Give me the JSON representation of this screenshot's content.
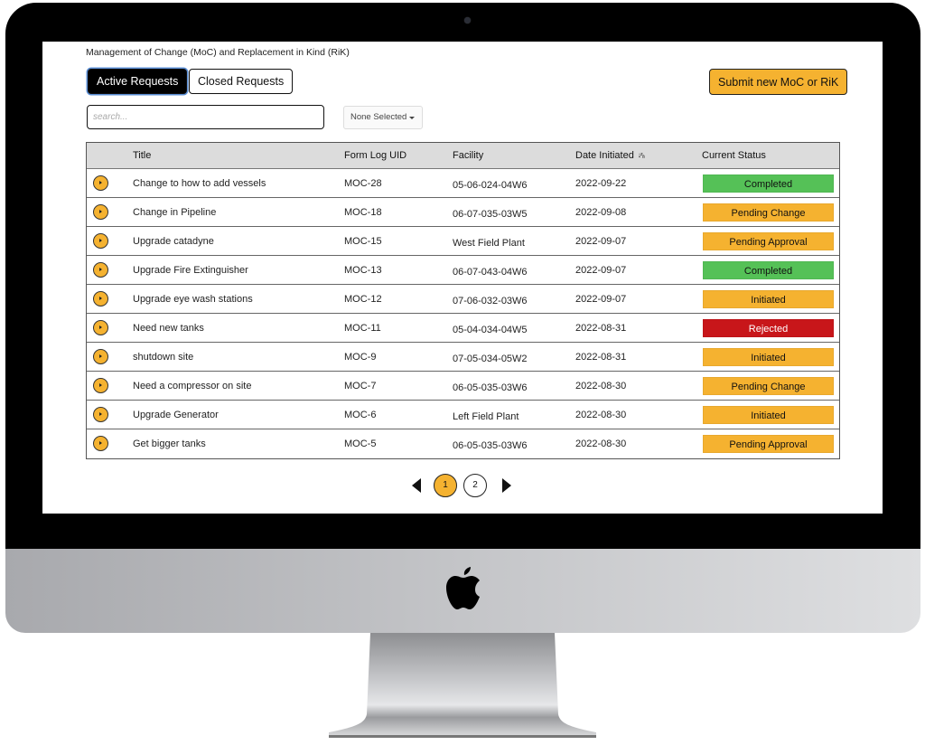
{
  "app": {
    "title": "Management of Change (MoC) and Replacement in Kind (RiK)"
  },
  "tabs": [
    {
      "label": "Active Requests",
      "active": true
    },
    {
      "label": "Closed Requests",
      "active": false
    }
  ],
  "toolbar": {
    "submit_label": "Submit new MoC or RiK",
    "search_placeholder": "search...",
    "search_value": "",
    "filter_selected": "None Selected"
  },
  "table": {
    "columns": [
      "Title",
      "Form Log UID",
      "Facility",
      "Date Initiated",
      "Current Status"
    ],
    "sort": {
      "column": "Date Initiated",
      "direction": "descending",
      "icon": "sort-z-a-icon"
    },
    "rows": [
      {
        "title": "Change to how to add vessels",
        "uid": "MOC-28",
        "facility": "05-06-024-04W6",
        "date": "2022-09-22",
        "status": "Completed"
      },
      {
        "title": "Change in Pipeline",
        "uid": "MOC-18",
        "facility": "06-07-035-03W5",
        "date": "2022-09-08",
        "status": "Pending Change"
      },
      {
        "title": "Upgrade catadyne",
        "uid": "MOC-15",
        "facility": "West Field Plant",
        "date": "2022-09-07",
        "status": "Pending Approval"
      },
      {
        "title": "Upgrade Fire Extinguisher",
        "uid": "MOC-13",
        "facility": "06-07-043-04W6",
        "date": "2022-09-07",
        "status": "Completed"
      },
      {
        "title": "Upgrade eye wash stations",
        "uid": "MOC-12",
        "facility": "07-06-032-03W6",
        "date": "2022-09-07",
        "status": "Initiated"
      },
      {
        "title": "Need new tanks",
        "uid": "MOC-11",
        "facility": "05-04-034-04W5",
        "date": "2022-08-31",
        "status": "Rejected"
      },
      {
        "title": "shutdown site",
        "uid": "MOC-9",
        "facility": "07-05-034-05W2",
        "date": "2022-08-31",
        "status": "Initiated"
      },
      {
        "title": "Need a compressor on site",
        "uid": "MOC-7",
        "facility": "06-05-035-03W6",
        "date": "2022-08-30",
        "status": "Pending Change"
      },
      {
        "title": "Upgrade Generator",
        "uid": "MOC-6",
        "facility": "Left Field Plant",
        "date": "2022-08-30",
        "status": "Initiated"
      },
      {
        "title": "Get bigger tanks",
        "uid": "MOC-5",
        "facility": "06-05-035-03W6",
        "date": "2022-08-30",
        "status": "Pending Approval"
      }
    ]
  },
  "status_colors": {
    "Completed": {
      "bg": "#55c157",
      "fg": "#111111"
    },
    "Pending Change": {
      "bg": "#f5b230",
      "fg": "#111111"
    },
    "Pending Approval": {
      "bg": "#f5b230",
      "fg": "#111111"
    },
    "Initiated": {
      "bg": "#f5b230",
      "fg": "#111111"
    },
    "Rejected": {
      "bg": "#c8161a",
      "fg": "#ffffff"
    }
  },
  "pagination": {
    "pages": [
      "1",
      "2"
    ],
    "current": "1"
  },
  "colors": {
    "accent": "#f5b230",
    "header_bg": "#dcdcdc"
  }
}
